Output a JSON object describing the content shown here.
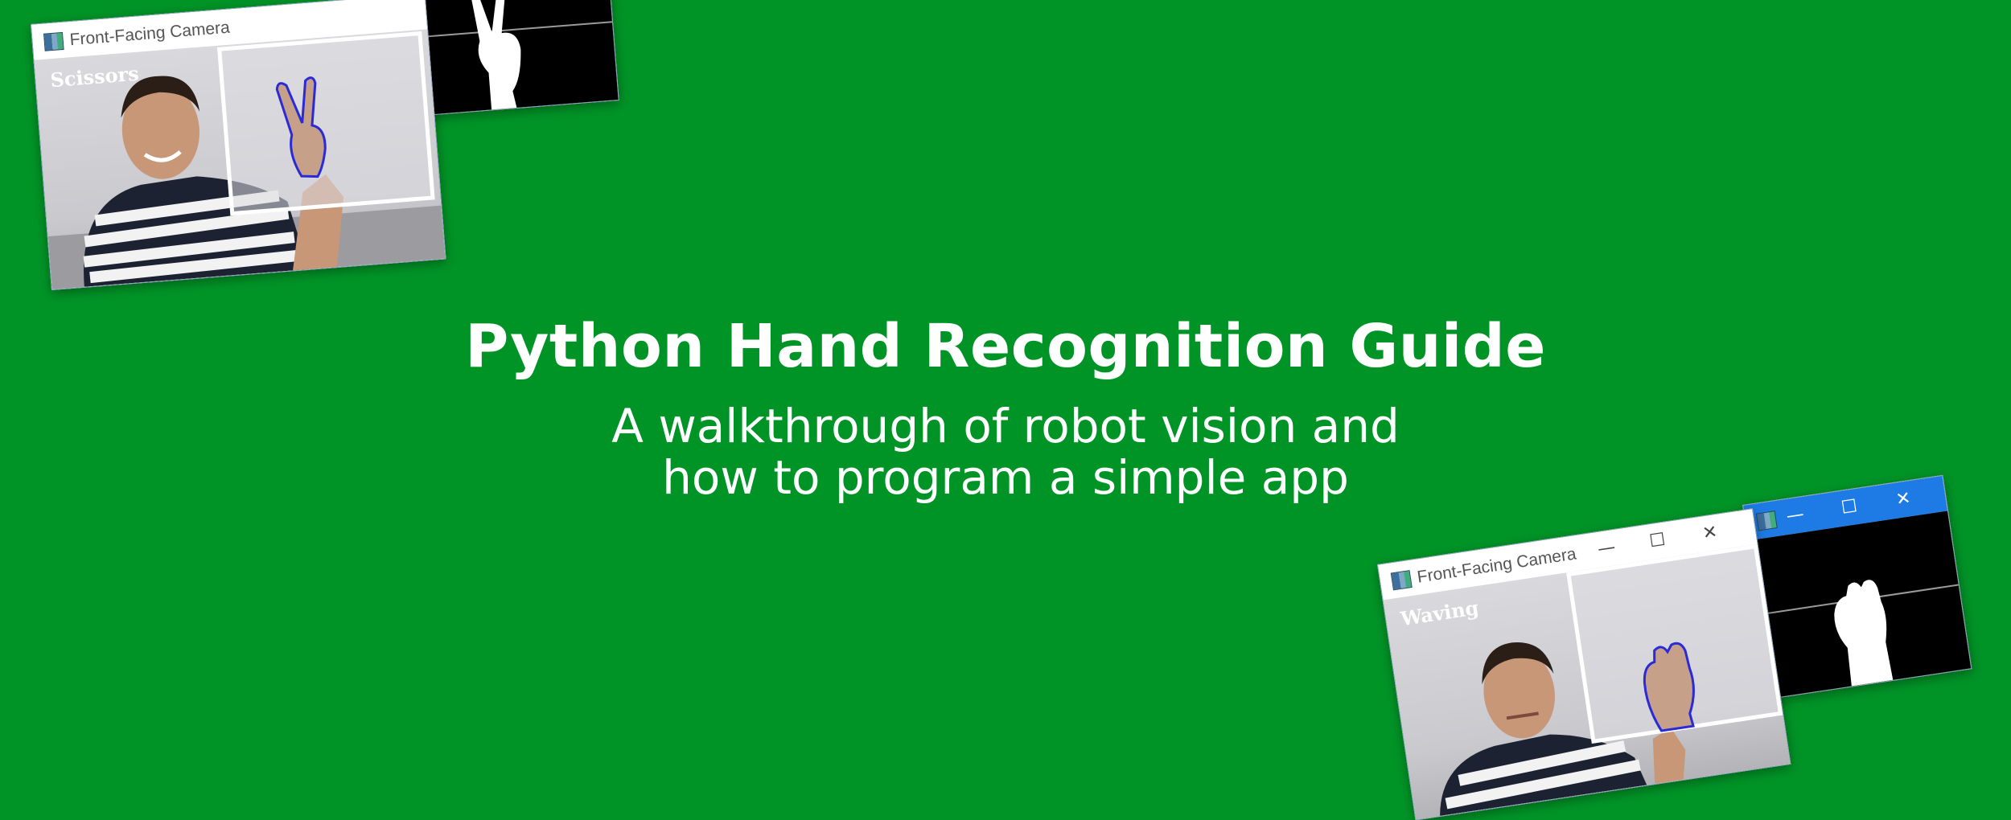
{
  "banner": {
    "title": "Python Hand Recognition Guide",
    "subtitle_line1": "A walkthrough of robot vision and",
    "subtitle_line2": "how to program a simple app"
  },
  "colors": {
    "background": "#009427",
    "text": "#ffffff",
    "contour": "#2a2ad8",
    "titlebar_accent": "#1e7be6"
  },
  "screenshots": [
    {
      "camera_window": {
        "title": "Front-Facing Camera",
        "icon": "app-window-icon",
        "gesture_label": "Scissors"
      },
      "mask_window": {
        "content": "binary-hand-mask"
      }
    },
    {
      "camera_window": {
        "title": "Front-Facing Camera",
        "icon": "app-window-icon",
        "gesture_label": "Waving",
        "buttons": {
          "minimize": "—",
          "maximize": "☐",
          "close": "✕"
        }
      },
      "mask_window": {
        "content": "binary-hand-mask",
        "buttons": {
          "minimize": "—",
          "maximize": "☐",
          "close": "✕"
        }
      }
    }
  ]
}
